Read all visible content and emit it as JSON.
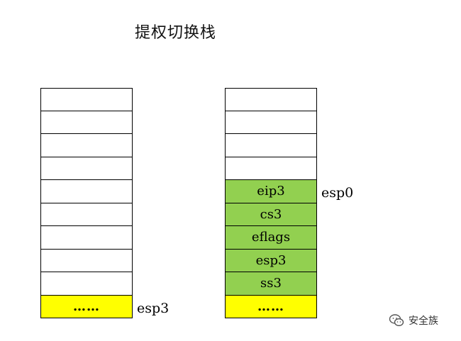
{
  "title": "提权切换栈",
  "left_stack": {
    "cells": [
      {
        "text": "",
        "color": "#ffffff"
      },
      {
        "text": "",
        "color": "#ffffff"
      },
      {
        "text": "",
        "color": "#ffffff"
      },
      {
        "text": "",
        "color": "#ffffff"
      },
      {
        "text": "",
        "color": "#ffffff"
      },
      {
        "text": "",
        "color": "#ffffff"
      },
      {
        "text": "",
        "color": "#ffffff"
      },
      {
        "text": "",
        "color": "#ffffff"
      },
      {
        "text": "",
        "color": "#ffffff"
      },
      {
        "text": "……",
        "color": "#ffff00"
      }
    ],
    "pointer_label": "esp3"
  },
  "right_stack": {
    "cells": [
      {
        "text": "",
        "color": "#ffffff"
      },
      {
        "text": "",
        "color": "#ffffff"
      },
      {
        "text": "",
        "color": "#ffffff"
      },
      {
        "text": "",
        "color": "#ffffff"
      },
      {
        "text": "eip3",
        "color": "#92d050"
      },
      {
        "text": "cs3",
        "color": "#92d050"
      },
      {
        "text": "eflags",
        "color": "#92d050"
      },
      {
        "text": "esp3",
        "color": "#92d050"
      },
      {
        "text": "ss3",
        "color": "#92d050"
      },
      {
        "text": "……",
        "color": "#ffff00"
      }
    ],
    "pointer_label": "esp0"
  },
  "watermark": {
    "text": "安全族",
    "icon": "wechat-icon"
  }
}
